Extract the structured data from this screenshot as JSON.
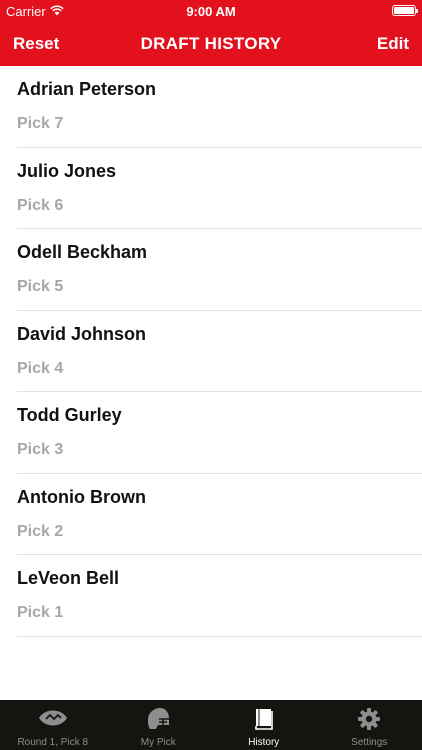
{
  "status_bar": {
    "carrier": "Carrier",
    "time": "9:00 AM"
  },
  "nav": {
    "left_button": "Reset",
    "title": "DRAFT HISTORY",
    "right_button": "Edit"
  },
  "picks": [
    {
      "player": "Adrian Peterson",
      "pick": "Pick 7"
    },
    {
      "player": "Julio Jones",
      "pick": "Pick 6"
    },
    {
      "player": "Odell Beckham",
      "pick": "Pick 5"
    },
    {
      "player": "David Johnson",
      "pick": "Pick 4"
    },
    {
      "player": "Todd Gurley",
      "pick": "Pick 3"
    },
    {
      "player": "Antonio Brown",
      "pick": "Pick 2"
    },
    {
      "player": "LeVeon Bell",
      "pick": "Pick 1"
    }
  ],
  "tabs": [
    {
      "label": "Round 1, Pick 8",
      "icon": "football-icon",
      "active": false
    },
    {
      "label": "My Pick",
      "icon": "helmet-icon",
      "active": false
    },
    {
      "label": "History",
      "icon": "book-icon",
      "active": true
    },
    {
      "label": "Settings",
      "icon": "gear-icon",
      "active": false
    }
  ],
  "colors": {
    "brand_red": "#e3101d",
    "tabbar_bg": "#141410",
    "pick_gray": "#a7a7a7"
  }
}
